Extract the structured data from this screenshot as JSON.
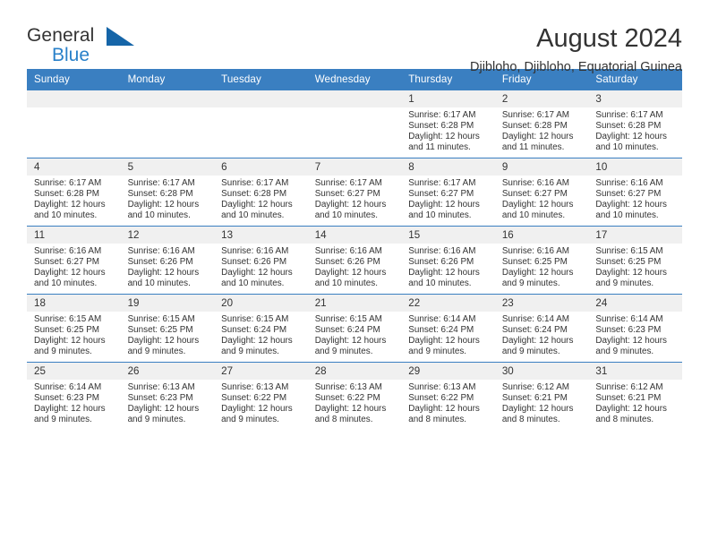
{
  "brand": {
    "word1": "General",
    "word2": "Blue",
    "accent_color": "#1565a8",
    "text_color": "#2980c9"
  },
  "header": {
    "title": "August 2024",
    "subtitle": "Djibloho, Djibloho, Equatorial Guinea"
  },
  "calendar": {
    "header_bg": "#3a7fc1",
    "weekday_headers": [
      "Sunday",
      "Monday",
      "Tuesday",
      "Wednesday",
      "Thursday",
      "Friday",
      "Saturday"
    ],
    "weeks": [
      [
        {
          "day": "",
          "lines": []
        },
        {
          "day": "",
          "lines": []
        },
        {
          "day": "",
          "lines": []
        },
        {
          "day": "",
          "lines": []
        },
        {
          "day": "1",
          "lines": [
            "Sunrise: 6:17 AM",
            "Sunset: 6:28 PM",
            "Daylight: 12 hours",
            "and 11 minutes."
          ]
        },
        {
          "day": "2",
          "lines": [
            "Sunrise: 6:17 AM",
            "Sunset: 6:28 PM",
            "Daylight: 12 hours",
            "and 11 minutes."
          ]
        },
        {
          "day": "3",
          "lines": [
            "Sunrise: 6:17 AM",
            "Sunset: 6:28 PM",
            "Daylight: 12 hours",
            "and 10 minutes."
          ]
        }
      ],
      [
        {
          "day": "4",
          "lines": [
            "Sunrise: 6:17 AM",
            "Sunset: 6:28 PM",
            "Daylight: 12 hours",
            "and 10 minutes."
          ]
        },
        {
          "day": "5",
          "lines": [
            "Sunrise: 6:17 AM",
            "Sunset: 6:28 PM",
            "Daylight: 12 hours",
            "and 10 minutes."
          ]
        },
        {
          "day": "6",
          "lines": [
            "Sunrise: 6:17 AM",
            "Sunset: 6:28 PM",
            "Daylight: 12 hours",
            "and 10 minutes."
          ]
        },
        {
          "day": "7",
          "lines": [
            "Sunrise: 6:17 AM",
            "Sunset: 6:27 PM",
            "Daylight: 12 hours",
            "and 10 minutes."
          ]
        },
        {
          "day": "8",
          "lines": [
            "Sunrise: 6:17 AM",
            "Sunset: 6:27 PM",
            "Daylight: 12 hours",
            "and 10 minutes."
          ]
        },
        {
          "day": "9",
          "lines": [
            "Sunrise: 6:16 AM",
            "Sunset: 6:27 PM",
            "Daylight: 12 hours",
            "and 10 minutes."
          ]
        },
        {
          "day": "10",
          "lines": [
            "Sunrise: 6:16 AM",
            "Sunset: 6:27 PM",
            "Daylight: 12 hours",
            "and 10 minutes."
          ]
        }
      ],
      [
        {
          "day": "11",
          "lines": [
            "Sunrise: 6:16 AM",
            "Sunset: 6:27 PM",
            "Daylight: 12 hours",
            "and 10 minutes."
          ]
        },
        {
          "day": "12",
          "lines": [
            "Sunrise: 6:16 AM",
            "Sunset: 6:26 PM",
            "Daylight: 12 hours",
            "and 10 minutes."
          ]
        },
        {
          "day": "13",
          "lines": [
            "Sunrise: 6:16 AM",
            "Sunset: 6:26 PM",
            "Daylight: 12 hours",
            "and 10 minutes."
          ]
        },
        {
          "day": "14",
          "lines": [
            "Sunrise: 6:16 AM",
            "Sunset: 6:26 PM",
            "Daylight: 12 hours",
            "and 10 minutes."
          ]
        },
        {
          "day": "15",
          "lines": [
            "Sunrise: 6:16 AM",
            "Sunset: 6:26 PM",
            "Daylight: 12 hours",
            "and 10 minutes."
          ]
        },
        {
          "day": "16",
          "lines": [
            "Sunrise: 6:16 AM",
            "Sunset: 6:25 PM",
            "Daylight: 12 hours",
            "and 9 minutes."
          ]
        },
        {
          "day": "17",
          "lines": [
            "Sunrise: 6:15 AM",
            "Sunset: 6:25 PM",
            "Daylight: 12 hours",
            "and 9 minutes."
          ]
        }
      ],
      [
        {
          "day": "18",
          "lines": [
            "Sunrise: 6:15 AM",
            "Sunset: 6:25 PM",
            "Daylight: 12 hours",
            "and 9 minutes."
          ]
        },
        {
          "day": "19",
          "lines": [
            "Sunrise: 6:15 AM",
            "Sunset: 6:25 PM",
            "Daylight: 12 hours",
            "and 9 minutes."
          ]
        },
        {
          "day": "20",
          "lines": [
            "Sunrise: 6:15 AM",
            "Sunset: 6:24 PM",
            "Daylight: 12 hours",
            "and 9 minutes."
          ]
        },
        {
          "day": "21",
          "lines": [
            "Sunrise: 6:15 AM",
            "Sunset: 6:24 PM",
            "Daylight: 12 hours",
            "and 9 minutes."
          ]
        },
        {
          "day": "22",
          "lines": [
            "Sunrise: 6:14 AM",
            "Sunset: 6:24 PM",
            "Daylight: 12 hours",
            "and 9 minutes."
          ]
        },
        {
          "day": "23",
          "lines": [
            "Sunrise: 6:14 AM",
            "Sunset: 6:24 PM",
            "Daylight: 12 hours",
            "and 9 minutes."
          ]
        },
        {
          "day": "24",
          "lines": [
            "Sunrise: 6:14 AM",
            "Sunset: 6:23 PM",
            "Daylight: 12 hours",
            "and 9 minutes."
          ]
        }
      ],
      [
        {
          "day": "25",
          "lines": [
            "Sunrise: 6:14 AM",
            "Sunset: 6:23 PM",
            "Daylight: 12 hours",
            "and 9 minutes."
          ]
        },
        {
          "day": "26",
          "lines": [
            "Sunrise: 6:13 AM",
            "Sunset: 6:23 PM",
            "Daylight: 12 hours",
            "and 9 minutes."
          ]
        },
        {
          "day": "27",
          "lines": [
            "Sunrise: 6:13 AM",
            "Sunset: 6:22 PM",
            "Daylight: 12 hours",
            "and 9 minutes."
          ]
        },
        {
          "day": "28",
          "lines": [
            "Sunrise: 6:13 AM",
            "Sunset: 6:22 PM",
            "Daylight: 12 hours",
            "and 8 minutes."
          ]
        },
        {
          "day": "29",
          "lines": [
            "Sunrise: 6:13 AM",
            "Sunset: 6:22 PM",
            "Daylight: 12 hours",
            "and 8 minutes."
          ]
        },
        {
          "day": "30",
          "lines": [
            "Sunrise: 6:12 AM",
            "Sunset: 6:21 PM",
            "Daylight: 12 hours",
            "and 8 minutes."
          ]
        },
        {
          "day": "31",
          "lines": [
            "Sunrise: 6:12 AM",
            "Sunset: 6:21 PM",
            "Daylight: 12 hours",
            "and 8 minutes."
          ]
        }
      ]
    ]
  }
}
